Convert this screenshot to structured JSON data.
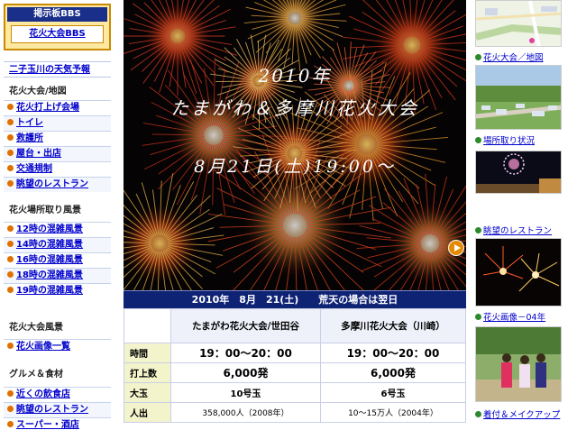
{
  "left": {
    "bbs_title": "掲示板BBS",
    "bbs_link": "花火大会BBS",
    "weather": "二子玉川の天気予報",
    "sections": [
      {
        "heading": "花火大会/地図",
        "items": [
          "花火打上げ会場",
          "トイレ",
          "救護所",
          "屋台・出店",
          "交通規制",
          "眺望のレストラン"
        ]
      },
      {
        "heading": "花火場所取り風景",
        "items": [
          "12時の混雑風景",
          "14時の混雑風景",
          "16時の混雑風景",
          "18時の混雑風景",
          "19時の混雑風景"
        ]
      },
      {
        "heading": "花火大会風景",
        "items": [
          "花火画像一覧"
        ]
      },
      {
        "heading": "グルメ＆食材",
        "items": [
          "近くの飲食店",
          "眺望のレストラン",
          "スーパー・酒店"
        ]
      }
    ]
  },
  "hero": {
    "year": "2010年",
    "name": "たまがわ＆多摩川花火大会",
    "date": "8月21日(土)19:00～"
  },
  "table": {
    "header": "2010年　8月　21(土)　　荒天の場合は翌日",
    "columns": [
      "たまがわ花火大会/世田谷",
      "多摩川花火大会（川崎）"
    ],
    "rows": [
      {
        "label": "時間",
        "a": "19：00～20：00",
        "b": "19：00～20：00"
      },
      {
        "label": "打上数",
        "a": "6,000発",
        "b": "6,000発"
      },
      {
        "label": "大玉",
        "a": "10号玉",
        "b": "6号玉"
      },
      {
        "label": "人出",
        "a": "358,000人（2008年）",
        "b": "10～15万人（2004年）"
      }
    ]
  },
  "right": {
    "links": [
      "花火大会／地図",
      "場所取り状況",
      "眺望のレストラン",
      "花火画像－04年",
      "着付＆メイクアップ"
    ]
  },
  "colors": {
    "nav_blue": "#0f2375",
    "link": "#0000cc",
    "bullet_orange": "#e07000",
    "bullet_green": "#2b8a2b"
  }
}
